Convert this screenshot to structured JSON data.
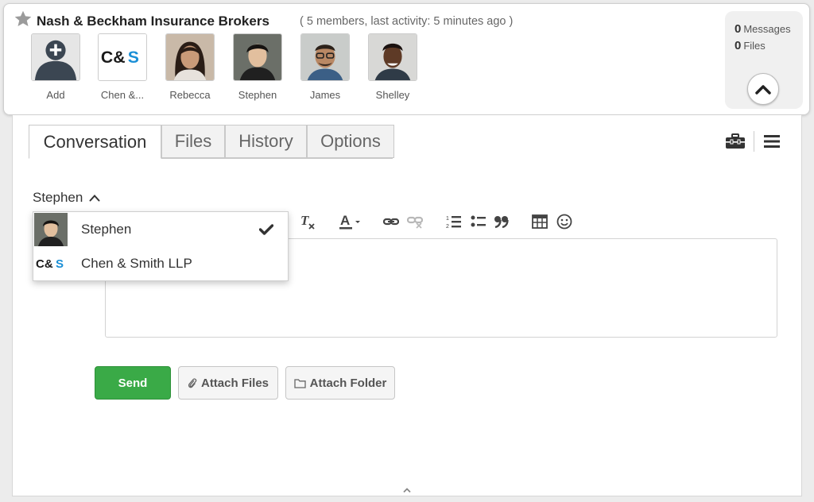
{
  "group": {
    "title": "Nash & Beckham Insurance Brokers",
    "meta": "( 5 members, last activity: 5 minutes ago )"
  },
  "members": [
    {
      "label": "Add",
      "icon": "add-member-icon"
    },
    {
      "label": "Chen &...",
      "logo_text": "C&S"
    },
    {
      "label": "Rebecca"
    },
    {
      "label": "Stephen"
    },
    {
      "label": "James"
    },
    {
      "label": "Shelley"
    }
  ],
  "stats": {
    "messages_count": "0",
    "messages_label": "Messages",
    "files_count": "0",
    "files_label": "Files"
  },
  "tabs": [
    {
      "label": "Conversation",
      "active": true
    },
    {
      "label": "Files"
    },
    {
      "label": "History"
    },
    {
      "label": "Options"
    }
  ],
  "compose": {
    "sender": "Stephen",
    "send_label": "Send",
    "attach_files_label": "Attach Files",
    "attach_folder_label": "Attach Folder"
  },
  "sender_menu": {
    "options": [
      {
        "label": "Stephen",
        "selected": true
      },
      {
        "label": "Chen & Smith LLP",
        "logo_text": "C&S"
      }
    ]
  },
  "colors": {
    "send_green": "#3aaa47",
    "logo_blue": "#1a8fd6",
    "logo_dark": "#1a1a1a"
  }
}
